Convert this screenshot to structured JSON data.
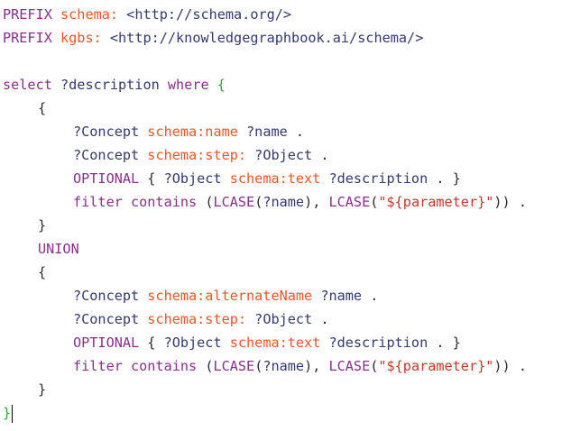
{
  "editor": {
    "lines": [
      {
        "tokens": [
          {
            "t": "kw",
            "v": "PREFIX "
          },
          {
            "t": "pfx",
            "v": "schema: "
          },
          {
            "t": "uri",
            "v": "<http://schema.org/>"
          }
        ]
      },
      {
        "tokens": [
          {
            "t": "kw",
            "v": "PREFIX "
          },
          {
            "t": "pfx",
            "v": "kgbs: "
          },
          {
            "t": "uri",
            "v": "<http://knowledgegraphbook.ai/schema/>"
          }
        ]
      },
      {
        "tokens": []
      },
      {
        "tokens": [
          {
            "t": "kw",
            "v": "select "
          },
          {
            "t": "var",
            "v": "?description "
          },
          {
            "t": "kw",
            "v": "where "
          },
          {
            "t": "brace-green",
            "v": "{"
          }
        ]
      },
      {
        "indent": 1,
        "tokens": [
          {
            "t": "plain",
            "v": "{"
          }
        ]
      },
      {
        "indent": 2,
        "tokens": [
          {
            "t": "var",
            "v": "?Concept "
          },
          {
            "t": "pfx",
            "v": "schema:name "
          },
          {
            "t": "var",
            "v": "?name "
          },
          {
            "t": "plain",
            "v": "."
          }
        ]
      },
      {
        "indent": 2,
        "tokens": [
          {
            "t": "var",
            "v": "?Concept "
          },
          {
            "t": "pfx",
            "v": "schema:step: "
          },
          {
            "t": "var",
            "v": "?Object "
          },
          {
            "t": "plain",
            "v": "."
          }
        ]
      },
      {
        "indent": 2,
        "tokens": [
          {
            "t": "kw",
            "v": "OPTIONAL "
          },
          {
            "t": "plain",
            "v": "{ "
          },
          {
            "t": "var",
            "v": "?Object "
          },
          {
            "t": "pfx",
            "v": "schema:text "
          },
          {
            "t": "var",
            "v": "?description "
          },
          {
            "t": "plain",
            "v": ". }"
          }
        ]
      },
      {
        "indent": 2,
        "tokens": [
          {
            "t": "kw",
            "v": "filter contains "
          },
          {
            "t": "plain",
            "v": "("
          },
          {
            "t": "kw",
            "v": "LCASE"
          },
          {
            "t": "plain",
            "v": "("
          },
          {
            "t": "var",
            "v": "?name"
          },
          {
            "t": "plain",
            "v": "), "
          },
          {
            "t": "kw",
            "v": "LCASE"
          },
          {
            "t": "plain",
            "v": "("
          },
          {
            "t": "str",
            "v": "\"${parameter}\""
          },
          {
            "t": "plain",
            "v": ")) ."
          }
        ]
      },
      {
        "indent": 1,
        "tokens": [
          {
            "t": "plain",
            "v": "}"
          }
        ]
      },
      {
        "indent": 1,
        "tokens": [
          {
            "t": "kw",
            "v": "UNION"
          }
        ]
      },
      {
        "indent": 1,
        "tokens": [
          {
            "t": "plain",
            "v": "{"
          }
        ]
      },
      {
        "indent": 2,
        "tokens": [
          {
            "t": "var",
            "v": "?Concept "
          },
          {
            "t": "pfx",
            "v": "schema:alternateName "
          },
          {
            "t": "var",
            "v": "?name "
          },
          {
            "t": "plain",
            "v": "."
          }
        ]
      },
      {
        "indent": 2,
        "tokens": [
          {
            "t": "var",
            "v": "?Concept "
          },
          {
            "t": "pfx",
            "v": "schema:step: "
          },
          {
            "t": "var",
            "v": "?Object "
          },
          {
            "t": "plain",
            "v": "."
          }
        ]
      },
      {
        "indent": 2,
        "tokens": [
          {
            "t": "kw",
            "v": "OPTIONAL "
          },
          {
            "t": "plain",
            "v": "{ "
          },
          {
            "t": "var",
            "v": "?Object "
          },
          {
            "t": "pfx",
            "v": "schema:text "
          },
          {
            "t": "var",
            "v": "?description "
          },
          {
            "t": "plain",
            "v": ". }"
          }
        ]
      },
      {
        "indent": 2,
        "tokens": [
          {
            "t": "kw",
            "v": "filter contains "
          },
          {
            "t": "plain",
            "v": "("
          },
          {
            "t": "kw",
            "v": "LCASE"
          },
          {
            "t": "plain",
            "v": "("
          },
          {
            "t": "var",
            "v": "?name"
          },
          {
            "t": "plain",
            "v": "), "
          },
          {
            "t": "kw",
            "v": "LCASE"
          },
          {
            "t": "plain",
            "v": "("
          },
          {
            "t": "str",
            "v": "\"${parameter}\""
          },
          {
            "t": "plain",
            "v": ")) ."
          }
        ]
      },
      {
        "indent": 1,
        "tokens": [
          {
            "t": "plain",
            "v": "}"
          }
        ]
      },
      {
        "tokens": [
          {
            "t": "brace-green",
            "v": "}"
          }
        ],
        "caret": true
      }
    ]
  },
  "colors": {
    "keyword": "#8a2f8a",
    "prefix": "#e8572a",
    "variable": "#333a6e",
    "brace": "#2fa82f",
    "background": "#ffffff"
  }
}
